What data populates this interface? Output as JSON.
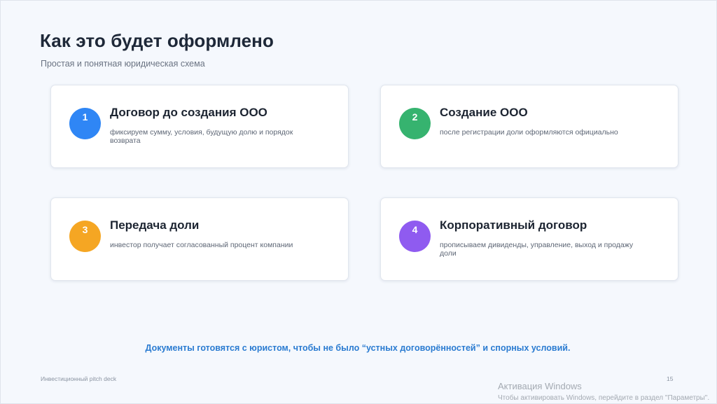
{
  "slide": {
    "title": "Как это будет оформлено",
    "subtitle": "Простая и понятная юридическая схема",
    "cards": [
      {
        "number": "1",
        "title": "Договор до создания ООО",
        "description": "фиксируем сумму, условия, будущую долю и порядок возврата",
        "color": "#2f86f5"
      },
      {
        "number": "2",
        "title": "Создание ООО",
        "description": "после регистрации доли оформляются официально",
        "color": "#36b36f"
      },
      {
        "number": "3",
        "title": "Передача доли",
        "description": "инвестор получает согласованный процент компании",
        "color": "#f5a623"
      },
      {
        "number": "4",
        "title": "Корпоративный договор",
        "description": "прописываем дивиденды, управление, выход и продажу доли",
        "color": "#8f5bf0"
      }
    ],
    "note": "Документы готовятся с юристом, чтобы не было “устных договорённостей” и спорных условий.",
    "footer": "Инвестиционный pitch deck",
    "page_number": "15"
  },
  "watermark": {
    "title": "Активация Windows",
    "subtitle": "Чтобы активировать Windows, перейдите в раздел \"Параметры\"."
  }
}
